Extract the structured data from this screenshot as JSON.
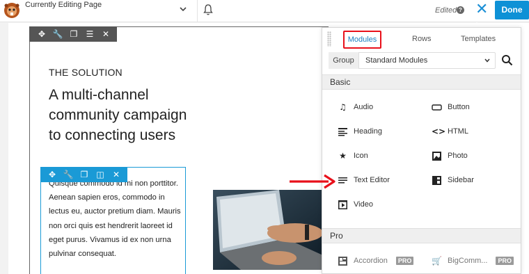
{
  "topbar": {
    "title": "Currently Editing Page",
    "status": "Edited",
    "help": "?",
    "close": "✕",
    "done_label": "Done"
  },
  "content": {
    "eyebrow": "THE SOLUTION",
    "headline": "A multi-channel community campaign to connecting users",
    "body": "Quisque commodo id mi non porttitor. Aenean sapien eros, commodo in lectus eu, auctor pretium diam. Mauris non orci quis est hendrerit laoreet id eget purus. Vivamus id ex non urna pulvinar consequat."
  },
  "panel": {
    "tabs": [
      "Modules",
      "Rows",
      "Templates"
    ],
    "group_label": "Group",
    "group_value": "Standard Modules",
    "sections": [
      {
        "title": "Basic",
        "items": [
          {
            "label": "Audio",
            "icon": "music-note-icon"
          },
          {
            "label": "Button",
            "icon": "button-icon"
          },
          {
            "label": "Heading",
            "icon": "heading-icon"
          },
          {
            "label": "HTML",
            "icon": "code-icon"
          },
          {
            "label": "Icon",
            "icon": "star-icon"
          },
          {
            "label": "Photo",
            "icon": "photo-icon"
          },
          {
            "label": "Text Editor",
            "icon": "text-editor-icon"
          },
          {
            "label": "Sidebar",
            "icon": "sidebar-icon"
          },
          {
            "label": "Video",
            "icon": "video-icon"
          }
        ]
      },
      {
        "title": "Pro",
        "items": [
          {
            "label": "Accordion",
            "icon": "accordion-icon",
            "badge": "PRO"
          },
          {
            "label": "BigComm...",
            "icon": "cart-icon",
            "badge": "PRO"
          }
        ]
      }
    ]
  },
  "colors": {
    "accent": "#0e91d6",
    "highlight": "#e8101a",
    "module_border": "#1a9ad6"
  }
}
